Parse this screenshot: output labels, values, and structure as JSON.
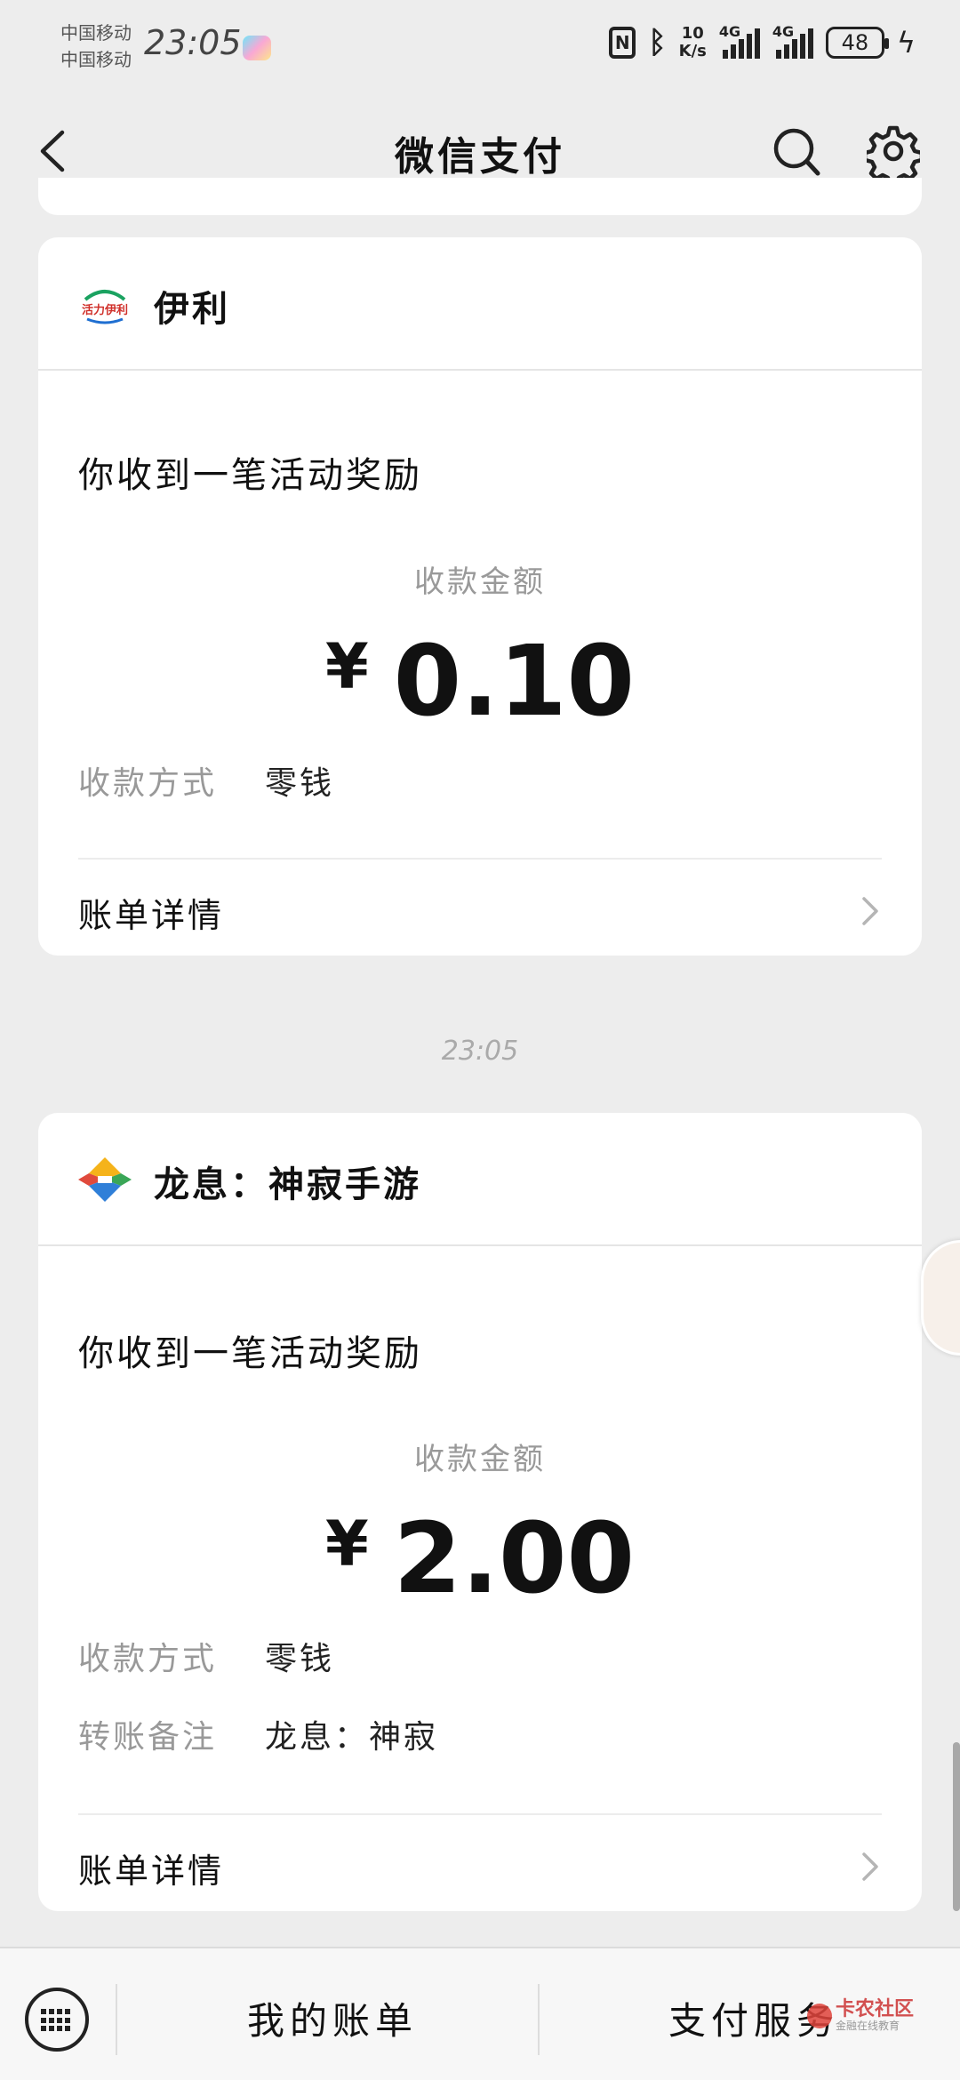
{
  "status_bar": {
    "carrier_1": "中国移动",
    "carrier_2": "中国移动",
    "time": "23:05",
    "nfc": "N",
    "net_speed_value": "10",
    "net_speed_unit": "K/s",
    "signal_1": "4G",
    "signal_2": "4G",
    "battery": "48"
  },
  "header": {
    "title": "微信支付",
    "back_icon": "chevron-left-icon",
    "search_icon": "search-icon",
    "settings_icon": "gear-icon"
  },
  "messages": [
    {
      "merchant": "伊利",
      "logo_text": "活力伊利",
      "title": "你收到一笔活动奖励",
      "amount_label": "收款金额",
      "currency": "¥",
      "amount": "0.10",
      "rows": [
        {
          "label": "收款方式",
          "value": "零钱"
        }
      ],
      "detail_label": "账单详情"
    },
    {
      "merchant": "龙息：神寂手游",
      "title": "你收到一笔活动奖励",
      "amount_label": "收款金额",
      "currency": "¥",
      "amount": "2.00",
      "rows": [
        {
          "label": "收款方式",
          "value": "零钱"
        },
        {
          "label": "转账备注",
          "value": "龙息：神寂"
        }
      ],
      "detail_label": "账单详情"
    }
  ],
  "timestamp": "23:05",
  "bottom_bar": {
    "tab_1": "我的账单",
    "tab_2": "支付服务",
    "watermark": "卡农社区",
    "watermark_sub": "金融在线教育"
  },
  "colors": {
    "background": "#ededed",
    "card": "#ffffff",
    "muted_text": "#999999"
  }
}
